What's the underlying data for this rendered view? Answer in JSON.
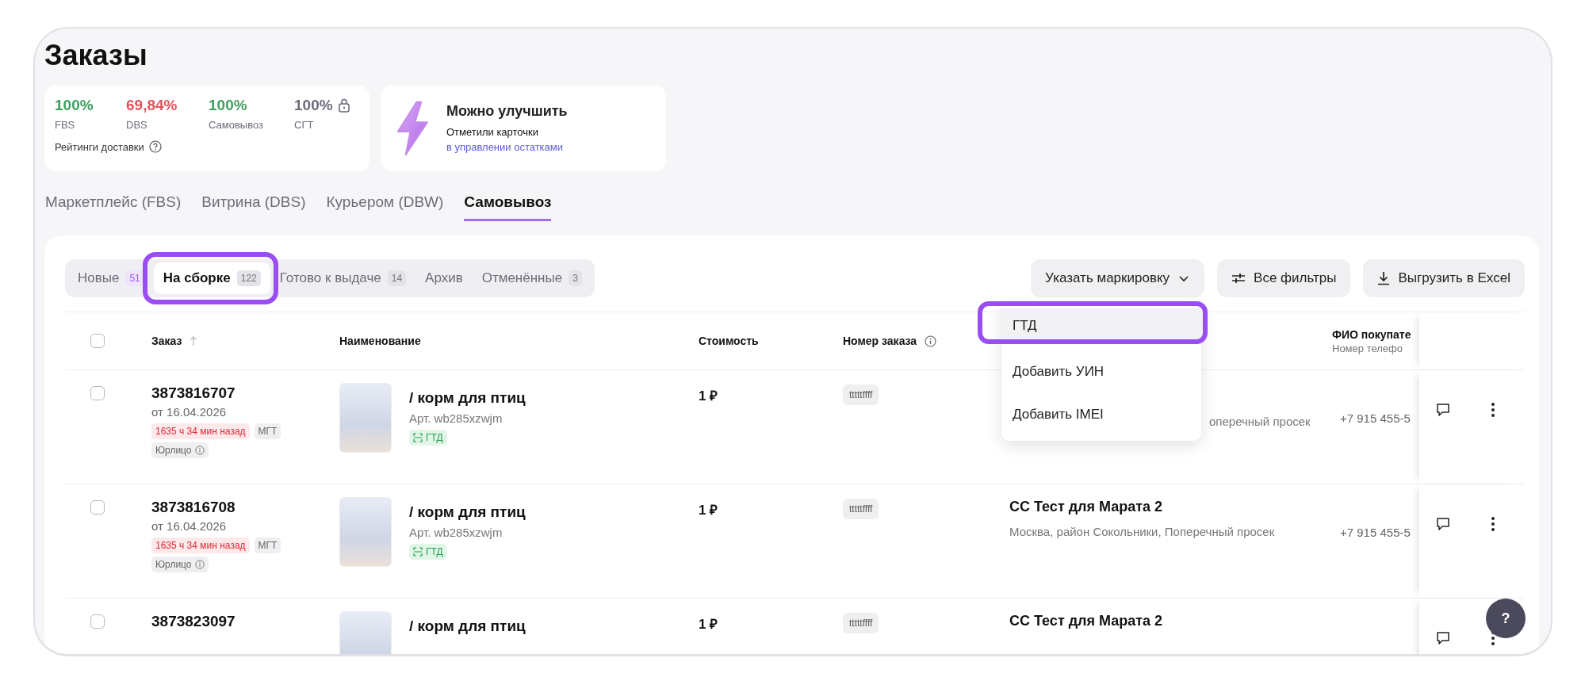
{
  "page_title": "Заказы",
  "delivery_ratings": {
    "metrics": [
      {
        "value": "100%",
        "label": "FBS",
        "color": "#3e9f5e",
        "locked": false
      },
      {
        "value": "69,84%",
        "label": "DBS",
        "color": "#e0545c",
        "locked": false
      },
      {
        "value": "100%",
        "label": "Самовывоз",
        "color": "#3e9f5e",
        "locked": false
      },
      {
        "value": "100%",
        "label": "СГТ",
        "color": "#6b6b7b",
        "locked": true
      }
    ],
    "caption": "Рейтинги доставки"
  },
  "promo": {
    "title": "Можно улучшить",
    "text": "Отметили карточки",
    "link": "в управлении остатками"
  },
  "delivery_tabs": [
    {
      "label": "Маркетплейс (FBS)",
      "selected": false
    },
    {
      "label": "Витрина (DBS)",
      "selected": false
    },
    {
      "label": "Курьером (DBW)",
      "selected": false
    },
    {
      "label": "Самовывоз",
      "selected": true
    }
  ],
  "status_tabs": [
    {
      "label": "Новые",
      "count": "51",
      "selected": false,
      "highlighted": false
    },
    {
      "label": "На сборке",
      "count": "122",
      "selected": true,
      "highlighted": true
    },
    {
      "label": "Готово к выдаче",
      "count": "14",
      "selected": false,
      "highlighted": false
    },
    {
      "label": "Архив",
      "selected": false,
      "highlighted": false
    },
    {
      "label": "Отменённые",
      "count": "3",
      "selected": false,
      "highlighted": false
    }
  ],
  "toolbar": {
    "marking_button": "Указать маркировку",
    "filters_button": "Все фильтры",
    "export_button": "Выгрузить в Excel"
  },
  "marking_menu": {
    "expanded": true,
    "items": [
      {
        "label": "ГТД",
        "selected": true,
        "highlighted": true
      },
      {
        "label": "Добавить УИН",
        "selected": false,
        "highlighted": false
      },
      {
        "label": "Добавить IMEI",
        "selected": false,
        "highlighted": false
      }
    ]
  },
  "table": {
    "all_checked": false,
    "columns": [
      {
        "kind": "sortable",
        "label": "Заказ"
      },
      {
        "kind": "plain",
        "label": "Наименование"
      },
      {
        "kind": "plain",
        "label": "Стоимость"
      },
      {
        "kind": "info",
        "label": "Номер заказа"
      },
      {
        "kind": "empty"
      },
      {
        "kind": "two_line",
        "label": "ФИО покупате",
        "sublabel": "Номер телефо"
      }
    ],
    "rows": [
      {
        "checked": false,
        "order_id": "3873816707",
        "date": "от 16.04.2026",
        "age_tag": "1635 ч 34 мин назад",
        "type_tag": "МГТ",
        "client_tag": "Юрлицо",
        "product": "/ корм для птиц",
        "sku": "Арт. wb285xzwjm",
        "marking_tag": "ГТД",
        "price": "1 ₽",
        "order_number": "tttttffff",
        "address": "оперечный просек",
        "phone": "+7 915 455-5"
      },
      {
        "checked": false,
        "order_id": "3873816708",
        "date": "от 16.04.2026",
        "age_tag": "1635 ч 34 мин назад",
        "type_tag": "МГТ",
        "client_tag": "Юрлицо",
        "product": "/ корм для птиц",
        "sku": "Арт. wb285xzwjm",
        "marking_tag": "ГТД",
        "price": "1 ₽",
        "order_number": "tttttffff",
        "buyer": "СС Тест для Марата 2",
        "address": "Москва, район Сокольники, Поперечный просек",
        "phone": "+7 915 455-5"
      },
      {
        "checked": false,
        "order_id": "3873823097",
        "product": "/ корм для птиц",
        "price": "1 ₽",
        "order_number": "tttttffff",
        "buyer": "СС Тест для Марата 2"
      }
    ]
  },
  "help_button": "?"
}
